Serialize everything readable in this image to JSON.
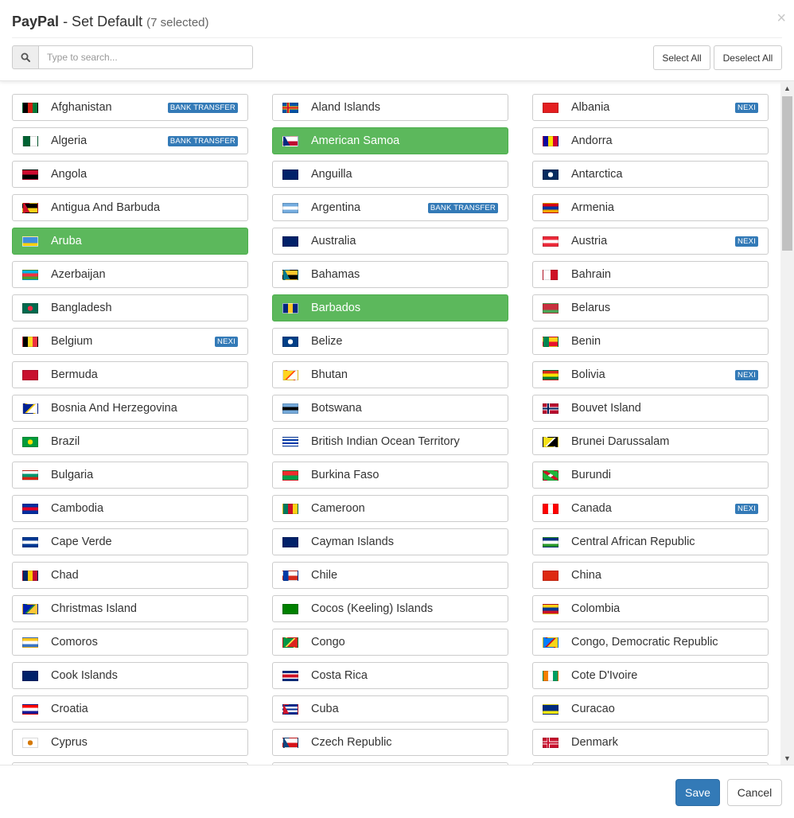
{
  "header": {
    "brand": "PayPal",
    "title_rest": "- Set Default",
    "selected_count": "(7 selected)",
    "close_glyph": "×"
  },
  "search": {
    "placeholder": "Type to search...",
    "value": "",
    "icon": "search-icon"
  },
  "toolbar": {
    "select_all_label": "Select All",
    "deselect_all_label": "Deselect All"
  },
  "footer": {
    "save_label": "Save",
    "cancel_label": "Cancel"
  },
  "colors": {
    "selected_green": "#5cb85c",
    "badge_blue": "#337ab7",
    "save_blue": "#337ab7"
  },
  "countries": [
    {
      "name": "Afghanistan",
      "badge": "BANK TRANSFER",
      "selected": false,
      "flag": [
        "#000000",
        "#d32011",
        "#007a36"
      ],
      "flagDir": "v"
    },
    {
      "name": "Aland Islands",
      "badge": "",
      "selected": false,
      "flag": [
        "#0053a5",
        "#ffce00",
        "#d21034"
      ],
      "flagDir": "nordic"
    },
    {
      "name": "Albania",
      "badge": "NEXI",
      "selected": false,
      "flag": [
        "#e41e20",
        "#e41e20",
        "#000000"
      ],
      "flagDir": "center"
    },
    {
      "name": "Algeria",
      "badge": "BANK TRANSFER",
      "selected": false,
      "flag": [
        "#006233",
        "#ffffff",
        "#d21034"
      ],
      "flagDir": "v2"
    },
    {
      "name": "American Samoa",
      "badge": "",
      "selected": true,
      "flag": [
        "#002b7f",
        "#ffffff",
        "#bf0a30"
      ],
      "flagDir": "tri"
    },
    {
      "name": "Andorra",
      "badge": "",
      "selected": false,
      "flag": [
        "#10069f",
        "#fedf00",
        "#d50032"
      ],
      "flagDir": "v"
    },
    {
      "name": "Angola",
      "badge": "",
      "selected": false,
      "flag": [
        "#cc092f",
        "#000000",
        "#ffcb00"
      ],
      "flagDir": "h2"
    },
    {
      "name": "Anguilla",
      "badge": "",
      "selected": false,
      "flag": [
        "#012169",
        "#c8102e",
        "#ffffff"
      ],
      "flagDir": "ensign"
    },
    {
      "name": "Antarctica",
      "badge": "",
      "selected": false,
      "flag": [
        "#072b5f",
        "#ffffff",
        "#072b5f"
      ],
      "flagDir": "center"
    },
    {
      "name": "Antigua And Barbuda",
      "badge": "",
      "selected": false,
      "flag": [
        "#ce1126",
        "#000000",
        "#fcd116"
      ],
      "flagDir": "tri"
    },
    {
      "name": "Argentina",
      "badge": "BANK TRANSFER",
      "selected": false,
      "flag": [
        "#74acdf",
        "#ffffff",
        "#74acdf"
      ],
      "flagDir": "h"
    },
    {
      "name": "Armenia",
      "badge": "",
      "selected": false,
      "flag": [
        "#d90012",
        "#0033a0",
        "#f2a800"
      ],
      "flagDir": "h"
    },
    {
      "name": "Aruba",
      "badge": "",
      "selected": true,
      "flag": [
        "#418fde",
        "#418fde",
        "#ffd100"
      ],
      "flagDir": "h"
    },
    {
      "name": "Australia",
      "badge": "",
      "selected": false,
      "flag": [
        "#012169",
        "#c8102e",
        "#ffffff"
      ],
      "flagDir": "ensign"
    },
    {
      "name": "Austria",
      "badge": "NEXI",
      "selected": false,
      "flag": [
        "#ed2939",
        "#ffffff",
        "#ed2939"
      ],
      "flagDir": "h"
    },
    {
      "name": "Azerbaijan",
      "badge": "",
      "selected": false,
      "flag": [
        "#00b5e2",
        "#ef3340",
        "#509e2f"
      ],
      "flagDir": "h"
    },
    {
      "name": "Bahamas",
      "badge": "",
      "selected": false,
      "flag": [
        "#00778b",
        "#ffc72c",
        "#000000"
      ],
      "flagDir": "tri"
    },
    {
      "name": "Bahrain",
      "badge": "",
      "selected": false,
      "flag": [
        "#ffffff",
        "#ce1126",
        "#ce1126"
      ],
      "flagDir": "v2"
    },
    {
      "name": "Bangladesh",
      "badge": "",
      "selected": false,
      "flag": [
        "#006a4e",
        "#f42a41",
        "#006a4e"
      ],
      "flagDir": "center"
    },
    {
      "name": "Barbados",
      "badge": "",
      "selected": true,
      "flag": [
        "#00267f",
        "#ffc726",
        "#00267f"
      ],
      "flagDir": "v"
    },
    {
      "name": "Belarus",
      "badge": "",
      "selected": false,
      "flag": [
        "#c8313e",
        "#c8313e",
        "#4aa657"
      ],
      "flagDir": "h"
    },
    {
      "name": "Belgium",
      "badge": "NEXI",
      "selected": false,
      "flag": [
        "#000000",
        "#fdda24",
        "#ef3340"
      ],
      "flagDir": "v"
    },
    {
      "name": "Belize",
      "badge": "",
      "selected": false,
      "flag": [
        "#003f87",
        "#ffffff",
        "#ce1126"
      ],
      "flagDir": "center"
    },
    {
      "name": "Benin",
      "badge": "",
      "selected": false,
      "flag": [
        "#008751",
        "#fcd116",
        "#e8112d"
      ],
      "flagDir": "benin"
    },
    {
      "name": "Bermuda",
      "badge": "",
      "selected": false,
      "flag": [
        "#c8102e",
        "#012169",
        "#ffffff"
      ],
      "flagDir": "ensign"
    },
    {
      "name": "Bhutan",
      "badge": "",
      "selected": false,
      "flag": [
        "#ffd520",
        "#ff4e12",
        "#ffffff"
      ],
      "flagDir": "diag"
    },
    {
      "name": "Bolivia",
      "badge": "NEXI",
      "selected": false,
      "flag": [
        "#d52b1e",
        "#f9e300",
        "#007934"
      ],
      "flagDir": "h"
    },
    {
      "name": "Bosnia And Herzegovina",
      "badge": "",
      "selected": false,
      "flag": [
        "#002395",
        "#fecb00",
        "#ffffff"
      ],
      "flagDir": "diag"
    },
    {
      "name": "Botswana",
      "badge": "",
      "selected": false,
      "flag": [
        "#75aadb",
        "#000000",
        "#75aadb"
      ],
      "flagDir": "h"
    },
    {
      "name": "Bouvet Island",
      "badge": "",
      "selected": false,
      "flag": [
        "#ba0c2f",
        "#ffffff",
        "#00205b"
      ],
      "flagDir": "nordic"
    },
    {
      "name": "Brazil",
      "badge": "",
      "selected": false,
      "flag": [
        "#009c3b",
        "#ffdf00",
        "#002776"
      ],
      "flagDir": "center"
    },
    {
      "name": "British Indian Ocean Territory",
      "badge": "",
      "selected": false,
      "flag": [
        "#ffffff",
        "#0038a8",
        "#ffffff"
      ],
      "flagDir": "waves"
    },
    {
      "name": "Brunei Darussalam",
      "badge": "",
      "selected": false,
      "flag": [
        "#f7e017",
        "#ffffff",
        "#000000"
      ],
      "flagDir": "diag"
    },
    {
      "name": "Bulgaria",
      "badge": "",
      "selected": false,
      "flag": [
        "#ffffff",
        "#00966e",
        "#d62612"
      ],
      "flagDir": "h"
    },
    {
      "name": "Burkina Faso",
      "badge": "",
      "selected": false,
      "flag": [
        "#ef2b2d",
        "#009e49",
        "#fcd116"
      ],
      "flagDir": "h2"
    },
    {
      "name": "Burundi",
      "badge": "",
      "selected": false,
      "flag": [
        "#ce1126",
        "#1eb53a",
        "#ffffff"
      ],
      "flagDir": "x"
    },
    {
      "name": "Cambodia",
      "badge": "",
      "selected": false,
      "flag": [
        "#032ea1",
        "#e00025",
        "#032ea1"
      ],
      "flagDir": "h"
    },
    {
      "name": "Cameroon",
      "badge": "",
      "selected": false,
      "flag": [
        "#007a5e",
        "#ce1126",
        "#fcd116"
      ],
      "flagDir": "v"
    },
    {
      "name": "Canada",
      "badge": "NEXI",
      "selected": false,
      "flag": [
        "#ff0000",
        "#ffffff",
        "#ff0000"
      ],
      "flagDir": "v"
    },
    {
      "name": "Cape Verde",
      "badge": "",
      "selected": false,
      "flag": [
        "#003893",
        "#ffffff",
        "#003893"
      ],
      "flagDir": "h"
    },
    {
      "name": "Cayman Islands",
      "badge": "",
      "selected": false,
      "flag": [
        "#012169",
        "#c8102e",
        "#ffffff"
      ],
      "flagDir": "ensign"
    },
    {
      "name": "Central African Republic",
      "badge": "",
      "selected": false,
      "flag": [
        "#003082",
        "#ffffff",
        "#289728"
      ],
      "flagDir": "h"
    },
    {
      "name": "Chad",
      "badge": "",
      "selected": false,
      "flag": [
        "#002664",
        "#fecb00",
        "#c60c30"
      ],
      "flagDir": "v"
    },
    {
      "name": "Chile",
      "badge": "",
      "selected": false,
      "flag": [
        "#0039a6",
        "#ffffff",
        "#d52b1e"
      ],
      "flagDir": "chile"
    },
    {
      "name": "China",
      "badge": "",
      "selected": false,
      "flag": [
        "#de2910",
        "#de2910",
        "#de2910"
      ],
      "flagDir": "h"
    },
    {
      "name": "Christmas Island",
      "badge": "",
      "selected": false,
      "flag": [
        "#0021ad",
        "#1c8a42",
        "#ffc639"
      ],
      "flagDir": "diag"
    },
    {
      "name": "Cocos (Keeling) Islands",
      "badge": "",
      "selected": false,
      "flag": [
        "#008000",
        "#008000",
        "#ffe000"
      ],
      "flagDir": "center"
    },
    {
      "name": "Colombia",
      "badge": "",
      "selected": false,
      "flag": [
        "#fcd116",
        "#003893",
        "#ce1126"
      ],
      "flagDir": "h"
    },
    {
      "name": "Comoros",
      "badge": "",
      "selected": false,
      "flag": [
        "#ffc61e",
        "#ffffff",
        "#3a75c4"
      ],
      "flagDir": "h"
    },
    {
      "name": "Congo",
      "badge": "",
      "selected": false,
      "flag": [
        "#009543",
        "#fbde4a",
        "#dc241f"
      ],
      "flagDir": "diag"
    },
    {
      "name": "Congo, Democratic Republic",
      "badge": "",
      "selected": false,
      "flag": [
        "#007fff",
        "#ce1021",
        "#f7d618"
      ],
      "flagDir": "diag"
    },
    {
      "name": "Cook Islands",
      "badge": "",
      "selected": false,
      "flag": [
        "#012169",
        "#c8102e",
        "#ffffff"
      ],
      "flagDir": "ensign"
    },
    {
      "name": "Costa Rica",
      "badge": "",
      "selected": false,
      "flag": [
        "#002b7f",
        "#ffffff",
        "#ce1126"
      ],
      "flagDir": "h5"
    },
    {
      "name": "Cote D'Ivoire",
      "badge": "",
      "selected": false,
      "flag": [
        "#f77f00",
        "#ffffff",
        "#009e60"
      ],
      "flagDir": "v"
    },
    {
      "name": "Croatia",
      "badge": "",
      "selected": false,
      "flag": [
        "#ff0000",
        "#ffffff",
        "#171796"
      ],
      "flagDir": "h"
    },
    {
      "name": "Cuba",
      "badge": "",
      "selected": false,
      "flag": [
        "#002a8f",
        "#ffffff",
        "#cf142b"
      ],
      "flagDir": "h5tri"
    },
    {
      "name": "Curacao",
      "badge": "",
      "selected": false,
      "flag": [
        "#002b7f",
        "#002b7f",
        "#f9e814"
      ],
      "flagDir": "h"
    },
    {
      "name": "Cyprus",
      "badge": "",
      "selected": false,
      "flag": [
        "#ffffff",
        "#d57800",
        "#ffffff"
      ],
      "flagDir": "center"
    },
    {
      "name": "Czech Republic",
      "badge": "",
      "selected": false,
      "flag": [
        "#ffffff",
        "#d7141a",
        "#11457e"
      ],
      "flagDir": "czech"
    },
    {
      "name": "Denmark",
      "badge": "",
      "selected": false,
      "flag": [
        "#c8102e",
        "#ffffff",
        "#c8102e"
      ],
      "flagDir": "nordic"
    },
    {
      "name": "",
      "badge": "",
      "selected": false,
      "flag": [
        "#ffffff",
        "#ffffff",
        "#ffffff"
      ],
      "flagDir": "h"
    },
    {
      "name": "",
      "badge": "",
      "selected": false,
      "flag": [
        "#ffffff",
        "#ffffff",
        "#ffffff"
      ],
      "flagDir": "h"
    },
    {
      "name": "",
      "badge": "",
      "selected": false,
      "flag": [
        "#ffffff",
        "#ffffff",
        "#ffffff"
      ],
      "flagDir": "h"
    }
  ]
}
